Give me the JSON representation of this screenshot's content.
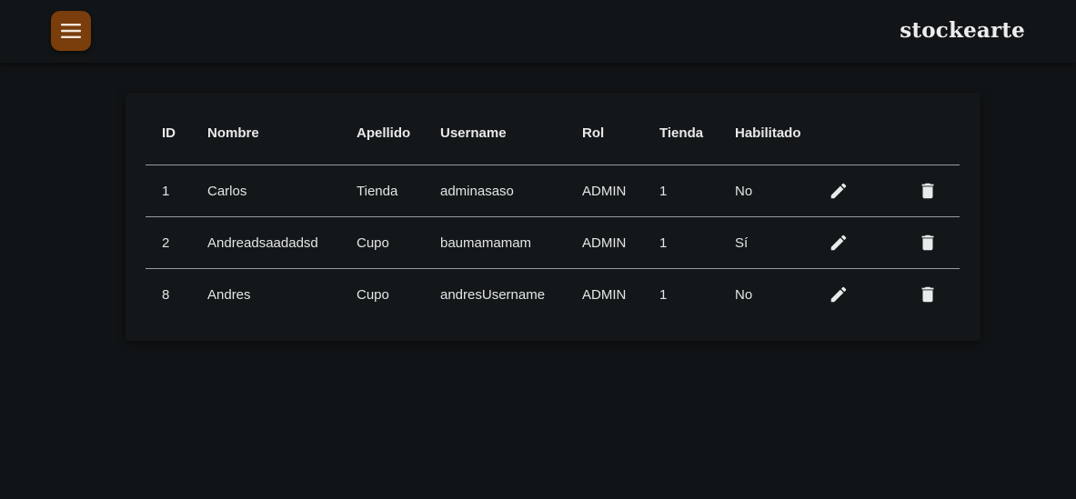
{
  "header": {
    "brand": "stockearte",
    "menu_icon": "menu-icon",
    "accent_color": "#7a3d0c"
  },
  "table": {
    "columns": [
      "ID",
      "Nombre",
      "Apellido",
      "Username",
      "Rol",
      "Tienda",
      "Habilitado"
    ],
    "rows": [
      {
        "id": "1",
        "nombre": "Carlos",
        "apellido": "Tienda",
        "username": "adminasaso",
        "rol": "ADMIN",
        "tienda": "1",
        "habilitado": "No"
      },
      {
        "id": "2",
        "nombre": "Andreadsaadadsd",
        "apellido": "Cupo",
        "username": "baumamamam",
        "rol": "ADMIN",
        "tienda": "1",
        "habilitado": "Sí"
      },
      {
        "id": "8",
        "nombre": "Andres",
        "apellido": "Cupo",
        "username": "andresUsername",
        "rol": "ADMIN",
        "tienda": "1",
        "habilitado": "No"
      }
    ],
    "row_actions": [
      "edit-icon",
      "trash-icon"
    ]
  }
}
